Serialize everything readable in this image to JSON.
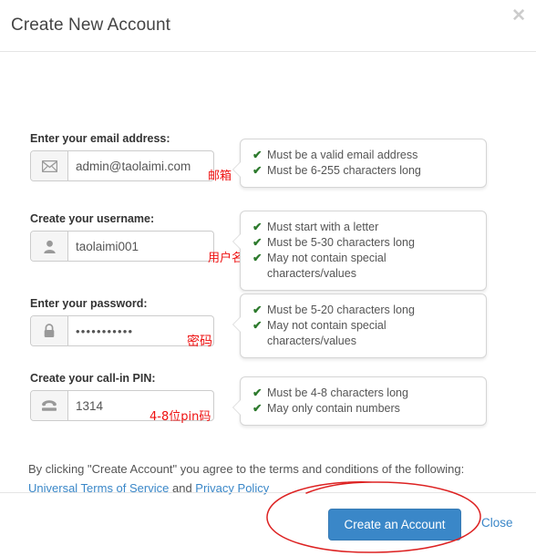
{
  "dialog": {
    "title": "Create New Account",
    "close_icon": "close-x-icon"
  },
  "fields": [
    {
      "label": "Enter your email address:",
      "icon": "envelope-icon",
      "value": "admin@taolaimi.com",
      "placeholder": "",
      "annotation": "邮箱",
      "rules": [
        "Must be a valid email address",
        "Must be 6-255 characters long"
      ]
    },
    {
      "label": "Create your username:",
      "icon": "user-icon",
      "value": "taolaimi001",
      "placeholder": "",
      "annotation": "用户名",
      "rules": [
        "Must start with a letter",
        "Must be 5-30 characters long",
        "May not contain special characters/values"
      ]
    },
    {
      "label": "Enter your password:",
      "icon": "lock-icon",
      "value": "•••••••••••",
      "placeholder": "",
      "annotation": "密码",
      "rules": [
        "Must be 5-20 characters long",
        "May not contain special characters/values"
      ]
    },
    {
      "label": "Create your call-in PIN:",
      "icon": "telephone-icon",
      "value": "1314",
      "placeholder": "",
      "annotation": "4-8位pin码",
      "rules": [
        "Must be 4-8 characters long",
        "May only contain numbers"
      ]
    }
  ],
  "terms": {
    "lead": "By clicking \"Create Account\" you agree to the terms and conditions of the following:",
    "link_terms": "Universal Terms of Service",
    "conjunction": " and ",
    "link_privacy": "Privacy Policy"
  },
  "footer": {
    "primary_label": "Create an Account",
    "close_label": "Close"
  },
  "colors": {
    "primary": "#3a87c8",
    "link": "#3a87c8",
    "check": "#2d7a2d",
    "annotation": "#ee1111"
  }
}
